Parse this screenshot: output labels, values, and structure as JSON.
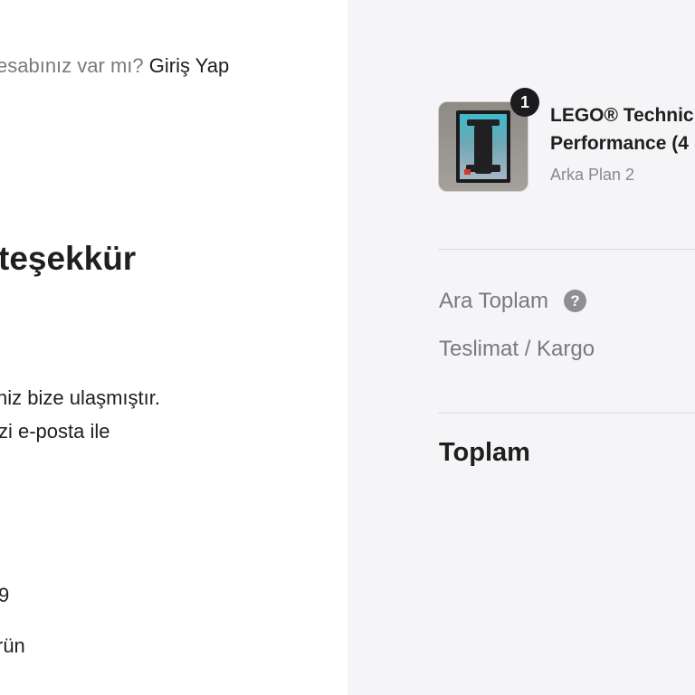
{
  "account": {
    "question": "esabınız var mı? ",
    "login_link": "Giriş Yap"
  },
  "confirmation": {
    "thanks": "teşekkür",
    "message_line1": "niz bize ulaşmıştır.",
    "message_line2": "zi e-posta ile",
    "value1": "9",
    "value2": "rün"
  },
  "cart": {
    "item": {
      "quantity_badge": "1",
      "name_line1": "LEGO® Technic",
      "name_line2": "Performance (4",
      "variant": "Arka Plan 2"
    },
    "summary": {
      "subtotal_label": "Ara Toplam",
      "help_icon": "question-icon",
      "help_glyph": "?",
      "shipping_label": "Teslimat / Kargo",
      "total_label": "Toplam"
    }
  },
  "colors": {
    "panel_bg": "#f5f5f7",
    "text": "#1f1f1f",
    "muted": "#7a7a7e",
    "badge": "#1c1c1e"
  }
}
